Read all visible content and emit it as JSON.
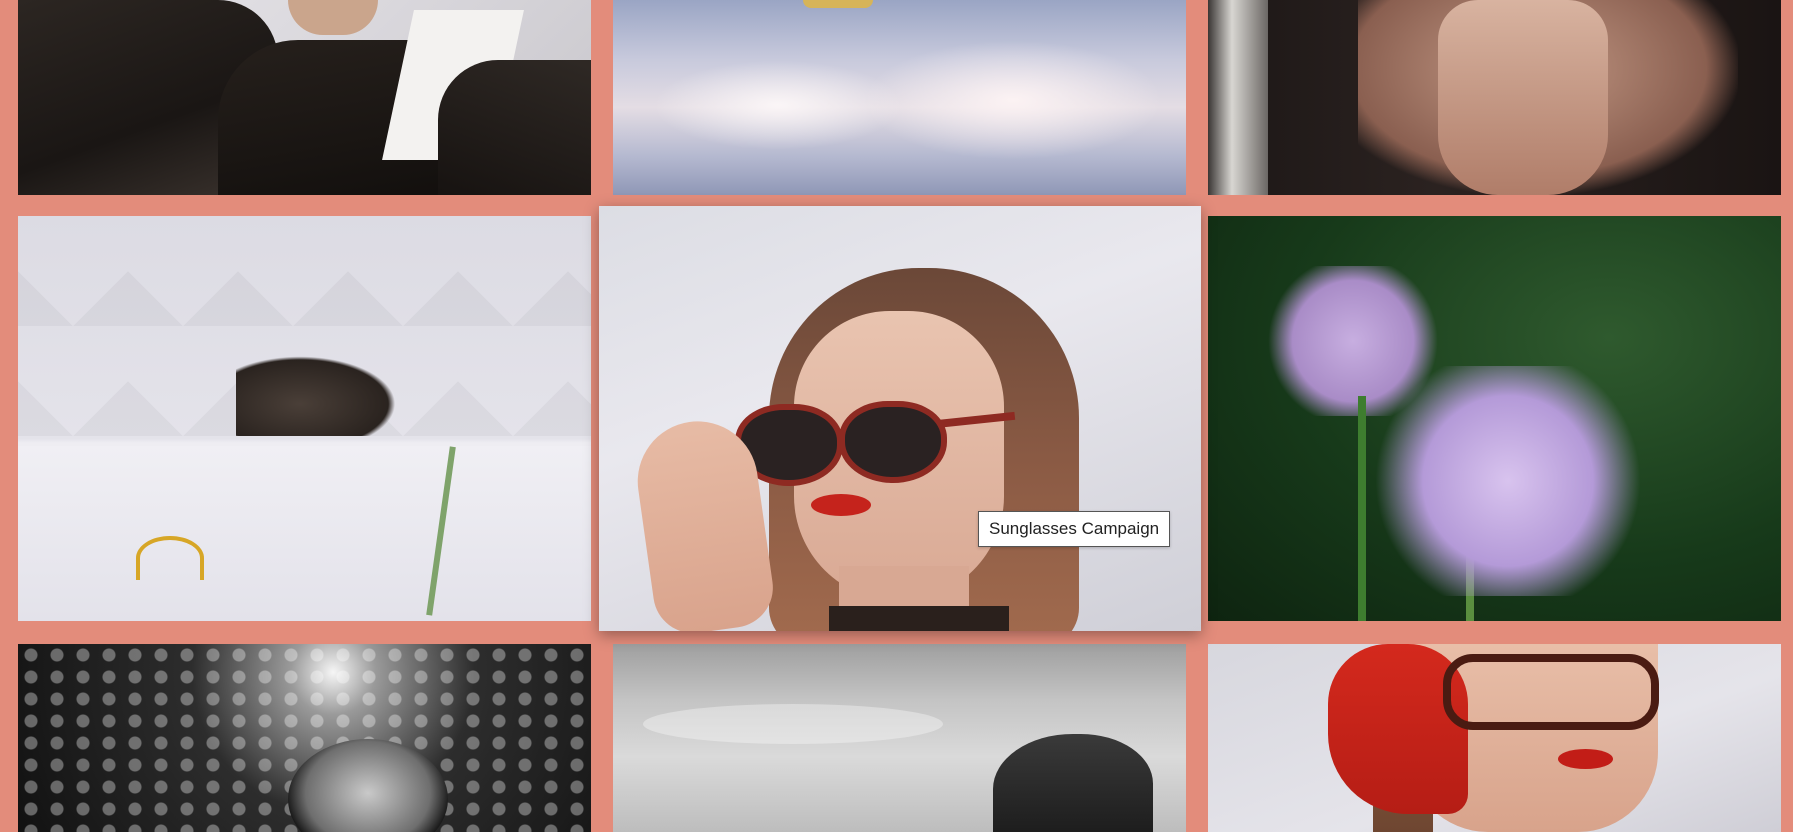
{
  "page": {
    "background_color": "#e38c7b"
  },
  "gallery": {
    "items": [
      {
        "id": "leather-jacket-photo"
      },
      {
        "id": "clouds-photo"
      },
      {
        "id": "hands-face-photo"
      },
      {
        "id": "cat-photo"
      },
      {
        "id": "sunglasses-woman-photo",
        "hovered": true
      },
      {
        "id": "flowers-photo"
      },
      {
        "id": "bw-portrait-photo"
      },
      {
        "id": "bw-rock-photo"
      },
      {
        "id": "red-beret-photo"
      }
    ]
  },
  "tooltip": {
    "text": "Sunglasses Campaign"
  }
}
